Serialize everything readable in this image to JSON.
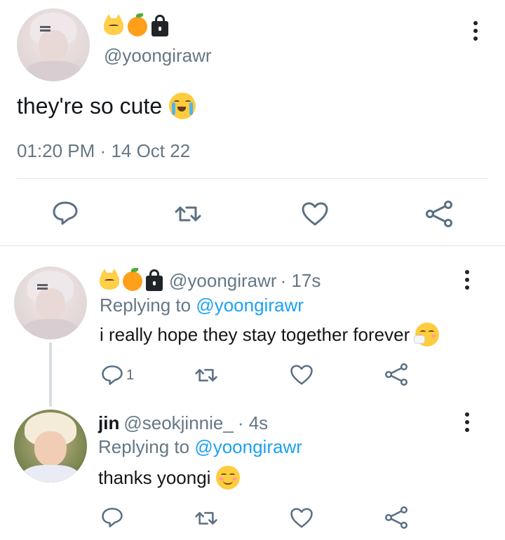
{
  "main_tweet": {
    "display_name_emojis": [
      "cat-face-icon",
      "tangerine-icon",
      "lock-icon"
    ],
    "handle": "@yoongirawr",
    "text": "they're so cute",
    "time": "01:20 PM",
    "separator": "·",
    "date": "14 Oct 22"
  },
  "replies": [
    {
      "display_name_emojis": [
        "cat-face-icon",
        "tangerine-icon",
        "lock-icon"
      ],
      "handle": "@yoongirawr",
      "age": "· 17s",
      "replying_prefix": "Replying to",
      "replying_to": "@yoongirawr",
      "text": "i really hope they stay together forever",
      "reply_count": "1"
    },
    {
      "display_name": "jin",
      "handle": "@seokjinnie_",
      "age": "· 4s",
      "replying_prefix": "Replying to",
      "replying_to": "@yoongirawr",
      "text": "thanks yoongi"
    }
  ],
  "colors": {
    "text": "#14171a",
    "muted": "#657786",
    "link": "#1da1f2",
    "icon": "#5b7083",
    "divider": "#e1e6ea"
  }
}
